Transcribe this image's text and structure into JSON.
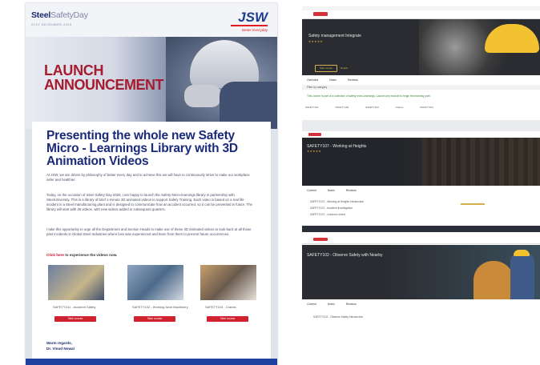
{
  "flyer": {
    "brand_bold": "Steel",
    "brand_rest": "SafetyDay",
    "brand_date": "21ST DECEMBER 2020",
    "company_logo": "JSW",
    "company_tagline": "Better Everyday",
    "announce_line1": "LAUNCH",
    "announce_line2": "ANNOUNCEMENT",
    "headline": "Presenting the whole new Safety Micro - Learnings Library with 3D Animation Videos",
    "para1": "At JSW, we are driven by philosophy of better every day and to achieve this we will have to continuously strive to make our workplace safer and healthier.",
    "para2": "Today, on the occasion of Steel Safety Day 2020, I am happy to launch the Safety Micro-learnings library in partnership with SteelUniversity. This is a library of brief 1-minute 3D animated videos to support Safety Training. Each video is based on a real life incident in a Steel manufacturing plant and is designed to communicate how an accident occurred, so it can be prevented in future. The library will start with 36 videos, with new videos added in subsequent quarters.",
    "para3": "I take this opportunity to urge all the Department and Section Heads to make use of these 3D animated videos to look back at all those past incidents in Global Steel Industries where loss was experienced and learn from them to prevent future occurrences.",
    "click_link": "Click here",
    "click_rest": " to experience the videos now.",
    "videos": [
      {
        "caption": "SAFETY101 - Accident Safety",
        "button": "Take course"
      },
      {
        "caption": "SAFETY102 - Working Near Machinery",
        "button": "Take course"
      },
      {
        "caption": "SAFETY103 - Cranes",
        "button": "Take course"
      }
    ],
    "sign_line1": "Warm regards,",
    "sign_line2": "Dr. Vinod Nowal"
  },
  "screens": [
    {
      "title": "Safety management Integrate",
      "rating": "★★★★★",
      "btn_primary": "Take course",
      "btn_secondary": "Details",
      "tabs": [
        "Overview",
        "Notes",
        "Reviews"
      ],
      "filter": "Filter by category",
      "notice": "This course is part of a collection of safety micro-learnings. Launch any module to begin the learning path.",
      "chips": [
        "SAFETY101",
        "SAFETY102",
        "SAFETY103",
        "Cranes",
        "SAFETY104"
      ]
    },
    {
      "title": "SAFETY107 - Working at Heights",
      "rating": "★★★★★",
      "tabs": [
        "Content",
        "Notes",
        "Reviews"
      ],
      "rows": [
        "SAFETY107 - Working at Heights Introduction",
        "SAFETY107 - Accident Investigation",
        "SAFETY107 - Lessons Learnt"
      ]
    },
    {
      "title": "SAFETY102 - Observe Safety with Nearby",
      "tabs": [
        "Content",
        "Notes",
        "Reviews"
      ],
      "row": "SAFETY102 - Observe Safety Introduction"
    }
  ],
  "colors": {
    "navy": "#1a2a7a",
    "accent_red": "#a61c2e",
    "button_red": "#d0212e",
    "gold": "#d3b04b",
    "banner_dark": "#2a2c31"
  }
}
